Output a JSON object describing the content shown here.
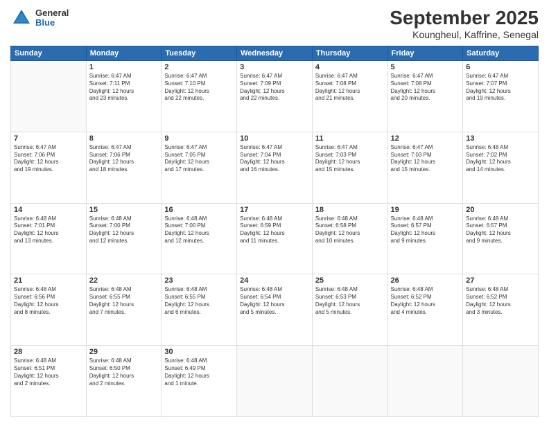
{
  "logo": {
    "general": "General",
    "blue": "Blue"
  },
  "title": "September 2025",
  "subtitle": "Koungheul, Kaffrine, Senegal",
  "header_row": [
    "Sunday",
    "Monday",
    "Tuesday",
    "Wednesday",
    "Thursday",
    "Friday",
    "Saturday"
  ],
  "weeks": [
    [
      {
        "day": "",
        "info": ""
      },
      {
        "day": "1",
        "info": "Sunrise: 6:47 AM\nSunset: 7:11 PM\nDaylight: 12 hours\nand 23 minutes."
      },
      {
        "day": "2",
        "info": "Sunrise: 6:47 AM\nSunset: 7:10 PM\nDaylight: 12 hours\nand 22 minutes."
      },
      {
        "day": "3",
        "info": "Sunrise: 6:47 AM\nSunset: 7:09 PM\nDaylight: 12 hours\nand 22 minutes."
      },
      {
        "day": "4",
        "info": "Sunrise: 6:47 AM\nSunset: 7:08 PM\nDaylight: 12 hours\nand 21 minutes."
      },
      {
        "day": "5",
        "info": "Sunrise: 6:47 AM\nSunset: 7:08 PM\nDaylight: 12 hours\nand 20 minutes."
      },
      {
        "day": "6",
        "info": "Sunrise: 6:47 AM\nSunset: 7:07 PM\nDaylight: 12 hours\nand 19 minutes."
      }
    ],
    [
      {
        "day": "7",
        "info": "Sunrise: 6:47 AM\nSunset: 7:06 PM\nDaylight: 12 hours\nand 19 minutes."
      },
      {
        "day": "8",
        "info": "Sunrise: 6:47 AM\nSunset: 7:06 PM\nDaylight: 12 hours\nand 18 minutes."
      },
      {
        "day": "9",
        "info": "Sunrise: 6:47 AM\nSunset: 7:05 PM\nDaylight: 12 hours\nand 17 minutes."
      },
      {
        "day": "10",
        "info": "Sunrise: 6:47 AM\nSunset: 7:04 PM\nDaylight: 12 hours\nand 16 minutes."
      },
      {
        "day": "11",
        "info": "Sunrise: 6:47 AM\nSunset: 7:03 PM\nDaylight: 12 hours\nand 15 minutes."
      },
      {
        "day": "12",
        "info": "Sunrise: 6:47 AM\nSunset: 7:03 PM\nDaylight: 12 hours\nand 15 minutes."
      },
      {
        "day": "13",
        "info": "Sunrise: 6:48 AM\nSunset: 7:02 PM\nDaylight: 12 hours\nand 14 minutes."
      }
    ],
    [
      {
        "day": "14",
        "info": "Sunrise: 6:48 AM\nSunset: 7:01 PM\nDaylight: 12 hours\nand 13 minutes."
      },
      {
        "day": "15",
        "info": "Sunrise: 6:48 AM\nSunset: 7:00 PM\nDaylight: 12 hours\nand 12 minutes."
      },
      {
        "day": "16",
        "info": "Sunrise: 6:48 AM\nSunset: 7:00 PM\nDaylight: 12 hours\nand 12 minutes."
      },
      {
        "day": "17",
        "info": "Sunrise: 6:48 AM\nSunset: 6:59 PM\nDaylight: 12 hours\nand 11 minutes."
      },
      {
        "day": "18",
        "info": "Sunrise: 6:48 AM\nSunset: 6:58 PM\nDaylight: 12 hours\nand 10 minutes."
      },
      {
        "day": "19",
        "info": "Sunrise: 6:48 AM\nSunset: 6:57 PM\nDaylight: 12 hours\nand 9 minutes."
      },
      {
        "day": "20",
        "info": "Sunrise: 6:48 AM\nSunset: 6:57 PM\nDaylight: 12 hours\nand 9 minutes."
      }
    ],
    [
      {
        "day": "21",
        "info": "Sunrise: 6:48 AM\nSunset: 6:56 PM\nDaylight: 12 hours\nand 8 minutes."
      },
      {
        "day": "22",
        "info": "Sunrise: 6:48 AM\nSunset: 6:55 PM\nDaylight: 12 hours\nand 7 minutes."
      },
      {
        "day": "23",
        "info": "Sunrise: 6:48 AM\nSunset: 6:55 PM\nDaylight: 12 hours\nand 6 minutes."
      },
      {
        "day": "24",
        "info": "Sunrise: 6:48 AM\nSunset: 6:54 PM\nDaylight: 12 hours\nand 5 minutes."
      },
      {
        "day": "25",
        "info": "Sunrise: 6:48 AM\nSunset: 6:53 PM\nDaylight: 12 hours\nand 5 minutes."
      },
      {
        "day": "26",
        "info": "Sunrise: 6:48 AM\nSunset: 6:52 PM\nDaylight: 12 hours\nand 4 minutes."
      },
      {
        "day": "27",
        "info": "Sunrise: 6:48 AM\nSunset: 6:52 PM\nDaylight: 12 hours\nand 3 minutes."
      }
    ],
    [
      {
        "day": "28",
        "info": "Sunrise: 6:48 AM\nSunset: 6:51 PM\nDaylight: 12 hours\nand 2 minutes."
      },
      {
        "day": "29",
        "info": "Sunrise: 6:48 AM\nSunset: 6:50 PM\nDaylight: 12 hours\nand 2 minutes."
      },
      {
        "day": "30",
        "info": "Sunrise: 6:48 AM\nSunset: 6:49 PM\nDaylight: 12 hours\nand 1 minute."
      },
      {
        "day": "",
        "info": ""
      },
      {
        "day": "",
        "info": ""
      },
      {
        "day": "",
        "info": ""
      },
      {
        "day": "",
        "info": ""
      }
    ]
  ]
}
